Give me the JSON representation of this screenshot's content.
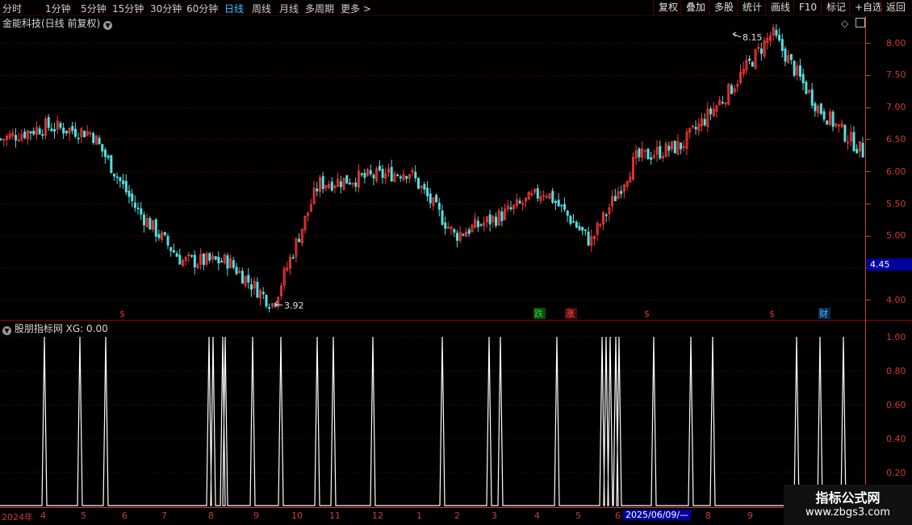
{
  "toolbar": {
    "periods": [
      "分时",
      "1分钟",
      "5分钟",
      "15分钟",
      "30分钟",
      "60分钟",
      "日线",
      "周线",
      "月线",
      "多周期",
      "更多 >"
    ],
    "active_period": "日线",
    "right_buttons": [
      "复权",
      "叠加",
      "多股",
      "统计",
      "画线",
      "F10",
      "标记",
      "+自选",
      "返回"
    ]
  },
  "main_chart": {
    "title": "金能科技(日线 前复权)",
    "y_axis_labels": [
      "8.00",
      "7.50",
      "7.00",
      "6.50",
      "6.00",
      "5.50",
      "5.00",
      "4.50",
      "4.00"
    ],
    "current_price_label": "4.45",
    "high_annotation": "8.15",
    "low_annotation": "3.92",
    "markers": [
      {
        "text": "$",
        "color": "#e03030"
      },
      {
        "text": "跌",
        "color": "#30d030"
      },
      {
        "text": "涨",
        "color": "#ff5050"
      },
      {
        "text": "$",
        "color": "#e03030"
      },
      {
        "text": "$",
        "color": "#e03030"
      },
      {
        "text": "财",
        "color": "#40c0ff"
      }
    ],
    "colors": {
      "up": "#ff3a3a",
      "down": "#55e0e0",
      "grid": "#7a0000",
      "axis": "#c83c3c"
    }
  },
  "indicator_panel": {
    "title": "股朋指标网 XG: 0.00",
    "y_axis_labels": [
      "1.00",
      "0.80",
      "0.60",
      "0.40",
      "0.20"
    ]
  },
  "x_axis": {
    "labels": [
      "2024年",
      "4",
      "5",
      "6",
      "7",
      "8",
      "9",
      "10",
      "11",
      "12",
      "1",
      "2",
      "3",
      "4",
      "5",
      "6",
      "8",
      "9"
    ],
    "cursor_date": "2025/06/09/—"
  },
  "watermark": {
    "line1": "指标公式网",
    "line2": "www.zbgs3.com"
  },
  "chart_data": {
    "type": "candlestick",
    "price_series_approx": [
      {
        "date": "2024-03",
        "price": 6.5
      },
      {
        "date": "2024-04",
        "price": 6.7
      },
      {
        "date": "2024-05",
        "price": 6.6
      },
      {
        "date": "2024-06",
        "price": 5.4
      },
      {
        "date": "2024-07",
        "price": 4.6
      },
      {
        "date": "2024-08",
        "price": 4.6
      },
      {
        "date": "2024-09",
        "price": 3.92
      },
      {
        "date": "2024-10",
        "price": 5.8
      },
      {
        "date": "2024-11",
        "price": 5.9
      },
      {
        "date": "2024-12",
        "price": 6.0
      },
      {
        "date": "2025-01",
        "price": 5.0
      },
      {
        "date": "2025-02",
        "price": 5.3
      },
      {
        "date": "2025-03",
        "price": 5.7
      },
      {
        "date": "2025-04",
        "price": 4.9
      },
      {
        "date": "2025-05",
        "price": 6.2
      },
      {
        "date": "2025-06",
        "price": 6.4
      },
      {
        "date": "2025-07",
        "price": 7.2
      },
      {
        "date": "2025-08",
        "price": 8.15
      },
      {
        "date": "2025-09",
        "price": 7.0
      },
      {
        "date": "2025-10",
        "price": 6.3
      }
    ],
    "ylim": [
      3.8,
      8.2
    ],
    "indicator": {
      "name": "XG",
      "ylim": [
        0,
        1
      ],
      "signal_count": 29
    }
  }
}
